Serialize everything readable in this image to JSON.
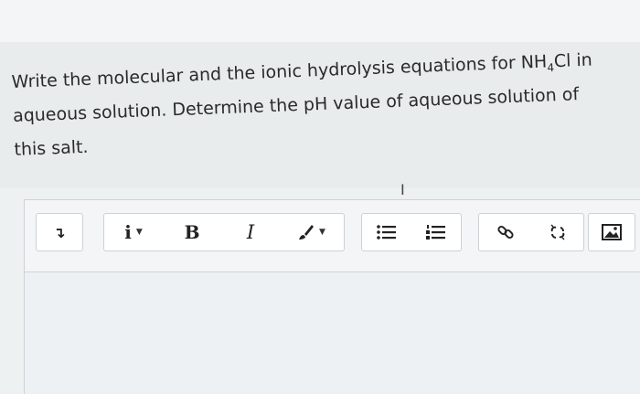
{
  "question": {
    "line1_pre": "Write the molecular and the ionic hydrolysis equations for NH",
    "line1_sub": "4",
    "line1_post": "Cl in",
    "line2": "aqueous solution. Determine the pH value of aqueous solution of",
    "line3": "this salt."
  },
  "toolbar": {
    "paragraph_glyph": "↴",
    "info_label": "i",
    "bold_label": "B",
    "italic_label": "I",
    "icons": [
      "paragraph-icon",
      "info-icon",
      "bold-icon",
      "italic-icon",
      "brush-icon",
      "bullet-list-icon",
      "numbered-list-icon",
      "link-icon",
      "unlink-icon",
      "image-icon"
    ]
  },
  "editor": {
    "cursor_glyph": "I"
  },
  "colors": {
    "text": "#2a2a2a",
    "toolbar_bg": "#ffffff",
    "editor_bg": "#eef1f3"
  }
}
